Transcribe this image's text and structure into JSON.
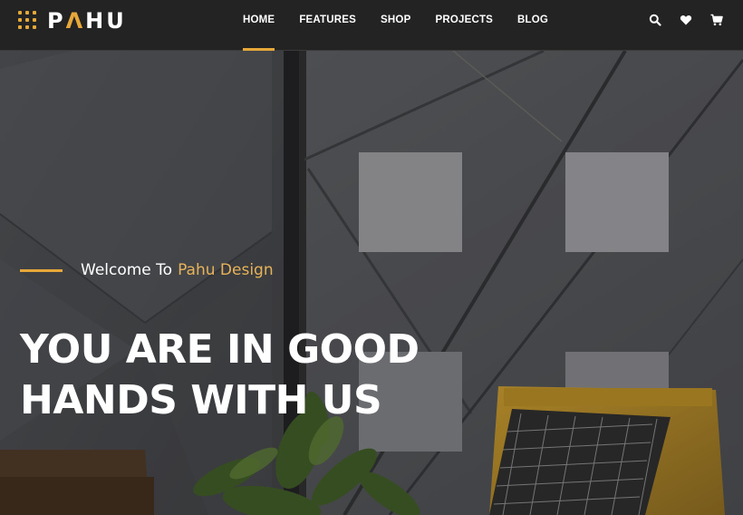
{
  "brand": {
    "name_first": "P",
    "name_accent": "Λ",
    "name_rest": "HU",
    "accent_color": "#e7a83a"
  },
  "nav": {
    "items": [
      {
        "label": "HOME",
        "active": true
      },
      {
        "label": "FEATURES",
        "active": false
      },
      {
        "label": "SHOP",
        "active": false
      },
      {
        "label": "PROJECTS",
        "active": false
      },
      {
        "label": "BLOG",
        "active": false
      }
    ]
  },
  "header_icons": [
    "search-icon",
    "heart-icon",
    "cart-icon"
  ],
  "hero": {
    "welcome_prefix": "Welcome To",
    "welcome_accent": "Pahu Design",
    "title_line_1": "YOU ARE IN GOOD",
    "title_line_2": "HANDS WITH US"
  }
}
